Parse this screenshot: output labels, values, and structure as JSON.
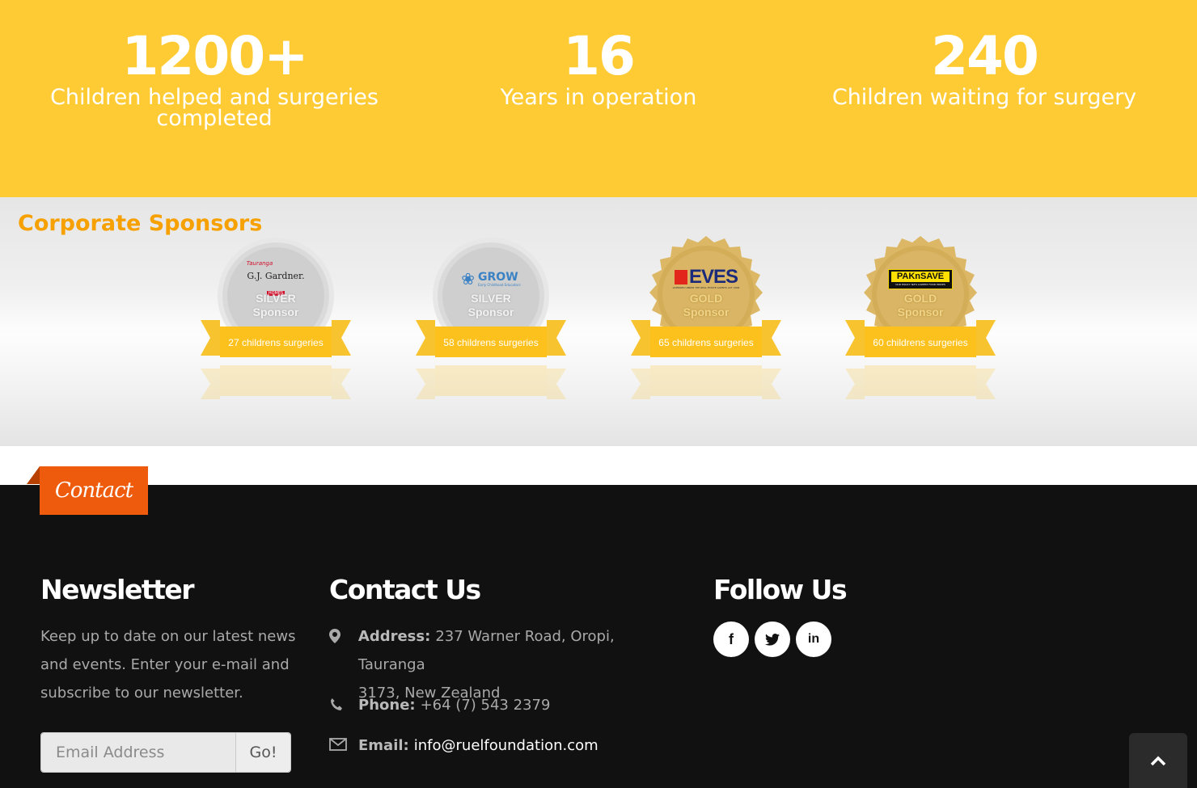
{
  "stats": [
    {
      "number": "1200+",
      "label_line1": "Children helped and surgeries",
      "label_line2": "completed"
    },
    {
      "number": "16",
      "label_line1": "Years in operation",
      "label_line2": ""
    },
    {
      "number": "240",
      "label_line1": "Children waiting for surgery",
      "label_line2": ""
    }
  ],
  "sponsors": {
    "title": "Corporate Sponsors",
    "badges": [
      {
        "logo_text": "G.J. Gardner.",
        "logo_sub": "Tauranga",
        "logo_tag": "HOMES",
        "tier": "SILVER",
        "tier_word": "Sponsor",
        "count": "27 childrens surgeries"
      },
      {
        "logo_text": "GROW",
        "logo_sub": "Early Childhood Educators",
        "tier": "SILVER",
        "tier_word": "Sponsor",
        "count": "58 childrens surgeries"
      },
      {
        "logo_text": "EVES",
        "logo_sub": "LICENSED UNDER THE REAL ESTATE AGENTS ACT 2008",
        "tier": "GOLD",
        "tier_word": "Sponsor",
        "count": "65 childrens surgeries"
      },
      {
        "logo_text": "PAKnSAVE",
        "logo_sub": "OUR POLICY: NZ'S LOWEST FOOD PRICES",
        "tier": "GOLD",
        "tier_word": "Sponsor",
        "count": "60 childrens surgeries"
      }
    ]
  },
  "contact_tab": {
    "label": "Contact"
  },
  "newsletter": {
    "title": "Newsletter",
    "text": "Keep up to date on our latest news and events. Enter your e-mail and subscribe to our newsletter.",
    "email_placeholder": "Email Address",
    "go_label": "Go!"
  },
  "contact_us": {
    "title": "Contact Us",
    "address_label": "Address:",
    "address_line1": "237 Warner Road, Oropi, Tauranga",
    "address_line2": "3173, New Zealand",
    "phone_label": "Phone:",
    "phone": "+64 (7) 543 2379",
    "email_label": "Email:",
    "email": "info@ruelfoundation.com"
  },
  "follow_us": {
    "title": "Follow Us",
    "icons": [
      "facebook-icon",
      "twitter-icon",
      "linkedin-icon"
    ],
    "facebook_glyph": "f",
    "linkedin_glyph": "in"
  },
  "colors": {
    "stats_bg": "#ffcb35",
    "accent_orange": "#ef5b0c",
    "sponsor_title": "#f6a100",
    "footer_bg": "#111111"
  }
}
